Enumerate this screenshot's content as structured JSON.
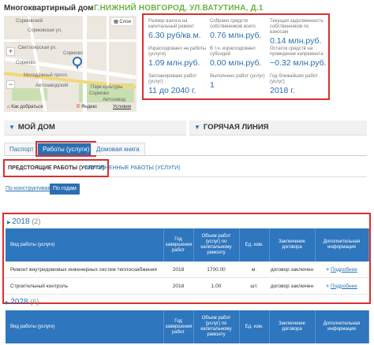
{
  "header": {
    "title": "Многоквартирный дом",
    "address": "г.Нижний Новгород, ул.Ватутина, д.1"
  },
  "map": {
    "chip": "Слои",
    "zoom_in": "+",
    "zoom_out": "−",
    "how_to_get": "Как добраться",
    "yandex": "Яндекс",
    "terms": "Условия",
    "labels": [
      "Сормовский",
      "Сормовская ул.",
      "Светлоярская ул.",
      "Сормово",
      "Сормово",
      "Молодёжный просп.",
      "Парк культуры",
      "Сормово",
      "Автозаводский",
      "Автозавод"
    ]
  },
  "stats": [
    {
      "title": "Размер взноса на капитальный ремонт",
      "value": "6.30 руб/кв.м."
    },
    {
      "title": "Собрано средств собственников всего",
      "value": "0.76 млн.руб."
    },
    {
      "title": "Текущая задолженность собственников по взносам",
      "value": "0.14 млн.руб."
    },
    {
      "title": "Израсходовано на работы (услуги)",
      "value": "1.09 млн.руб."
    },
    {
      "title": "В т.ч. израсходовано субсидий",
      "value": "0.00 млн.руб."
    },
    {
      "title": "Остаток средств на проведение капремонта",
      "value": "−0.32 млн.руб."
    },
    {
      "title": "Запланировано работ (услуг)",
      "value": "11 до 2040 г."
    },
    {
      "title": "Выполнено работ (услуг)",
      "value": "1"
    },
    {
      "title": "Год ближайших работ (услуг)",
      "value": "2018 г."
    }
  ],
  "sections": {
    "my_home": "МОЙ ДОМ",
    "hotline": "ГОРЯЧАЯ ЛИНИЯ"
  },
  "tabs": [
    "Паспорт",
    "Работы (услуги)",
    "Домовая книга"
  ],
  "subtabs": [
    "ПРЕДСТОЯЩИЕ РАБОТЫ (УСЛУГИ)",
    "ВЫПОЛНЕННЫЕ РАБОТЫ (УСЛУГИ)"
  ],
  "filters": {
    "by_construct": "По конструктивам",
    "by_year": "По годам"
  },
  "table_headers": [
    "Вид работы (услуги)",
    "Год завершения работ",
    "Объем работ (услуг) по капитальному ремонту",
    "Ед. изм.",
    "Заключение договора",
    "Дополнительная информация"
  ],
  "year_2018": {
    "year": "2018",
    "count": "(2)",
    "rows": [
      {
        "work": "Ремонт внутридомовых инженерных систем теплоснабжения",
        "year": "2018",
        "volume": "1700.00",
        "unit": "м.",
        "contract": "договор заключен",
        "more": "Подробнее"
      },
      {
        "work": "Строительный контроль",
        "year": "2018",
        "volume": "1.00",
        "unit": "шт.",
        "contract": "договор заключен",
        "more": "Подробнее"
      }
    ]
  },
  "year_2028": {
    "year": "2028",
    "count": "(6)"
  }
}
